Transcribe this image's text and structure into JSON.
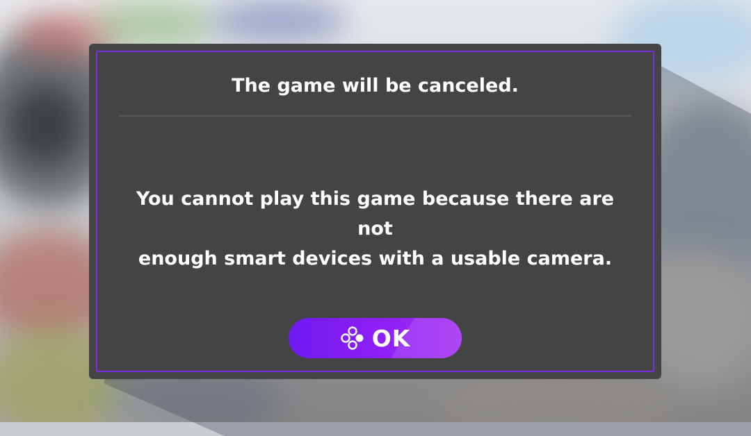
{
  "dialog": {
    "title": "The game will be canceled.",
    "message": "You cannot play this game because there are not\nenough smart devices with a usable camera.",
    "ok_label": "OK",
    "ok_icon": "a-button-icon",
    "accent_color": "#7a2fe0",
    "panel_color": "#444444"
  }
}
